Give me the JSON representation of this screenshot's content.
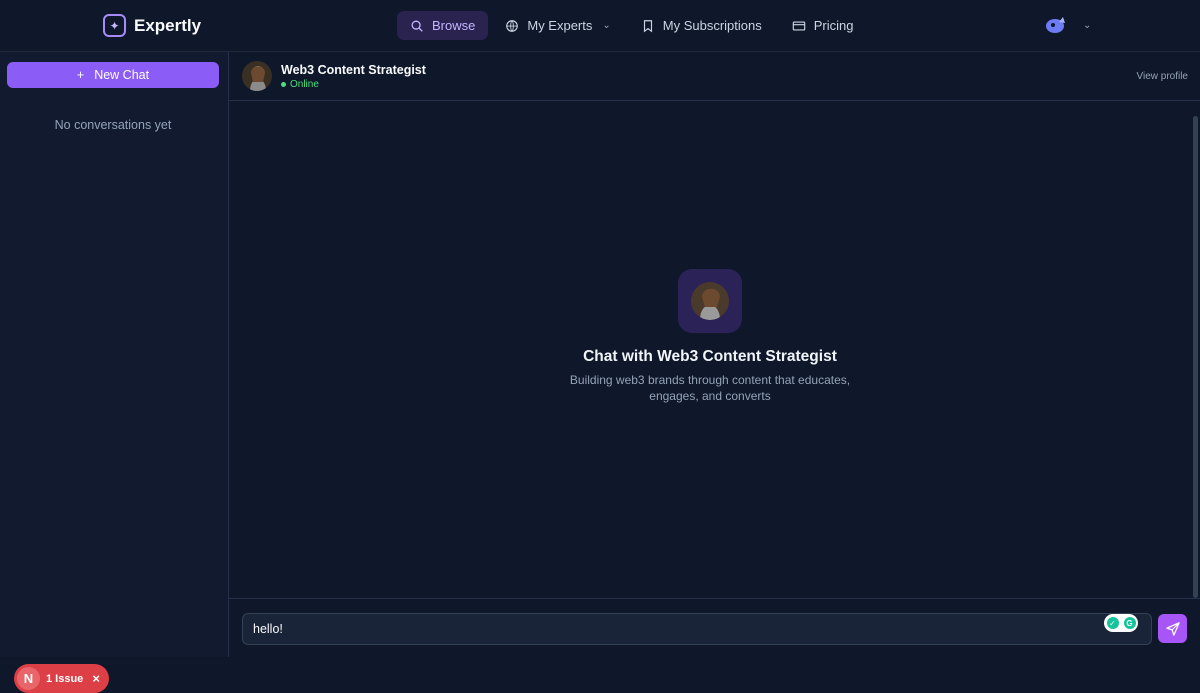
{
  "brand": {
    "name": "Expertly"
  },
  "nav": {
    "browse": "Browse",
    "my_experts": "My Experts",
    "my_subscriptions": "My Subscriptions",
    "pricing": "Pricing"
  },
  "sidebar": {
    "new_chat": "New Chat",
    "empty": "No conversations yet"
  },
  "header": {
    "name": "Web3 Content Strategist",
    "status": "Online",
    "view_profile": "View profile"
  },
  "empty_state": {
    "title": "Chat with Web3 Content Strategist",
    "subtitle": "Building web3 brands through content that educates, engages, and converts"
  },
  "composer": {
    "value": "hello!"
  },
  "issue_badge": {
    "label": "1 Issue",
    "initial": "N"
  },
  "colors": {
    "accent": "#8b5cf6",
    "online": "#4ade80",
    "issue": "#dc3f45"
  },
  "icons": {
    "search": "search-icon",
    "globe": "globe-icon",
    "bookmark": "bookmark-icon",
    "card": "credit-card-icon",
    "send": "send-icon"
  }
}
